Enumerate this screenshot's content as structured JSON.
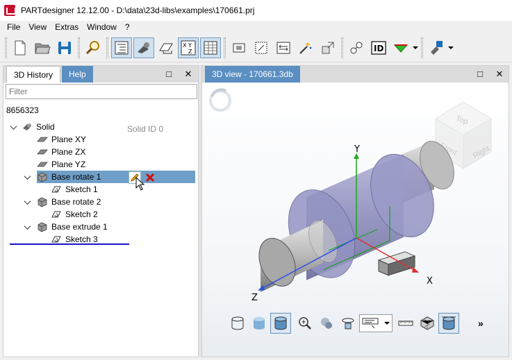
{
  "window": {
    "title": "PARTdesigner 12.12.00 - D:\\data\\23d-libs\\examples\\170661.prj"
  },
  "menu": [
    "File",
    "View",
    "Extras",
    "Window",
    "?"
  ],
  "toolbar": {
    "icons": [
      "new-file-icon",
      "open-folder-icon",
      "save-icon",
      "search-icon",
      "tree-view-icon",
      "camera-icon",
      "sketch-plane-icon",
      "xyz-axes-icon",
      "table-icon",
      "part-icon",
      "dimension-icon",
      "measure-icon",
      "magic-wand-icon",
      "export-icon",
      "assembly-icon",
      "id-icon",
      "variant-icon",
      "save-bolt-icon"
    ],
    "accent_green": "#2db82d",
    "accent_red": "#d01010"
  },
  "left_panel": {
    "tabs": [
      "3D History",
      "Help"
    ],
    "filter_placeholder": "Filter",
    "root_id": "8656323",
    "solid_id": "Solid ID 0",
    "tree": [
      {
        "label": "Solid",
        "icon": "solid-icon"
      },
      {
        "label": "Plane XY",
        "icon": "plane-icon"
      },
      {
        "label": "Plane ZX",
        "icon": "plane-icon"
      },
      {
        "label": "Plane YZ",
        "icon": "plane-icon"
      },
      {
        "label": "Base rotate 1",
        "icon": "feature-icon"
      },
      {
        "label": "Sketch 1",
        "icon": "sketch-icon"
      },
      {
        "label": "Base rotate 2",
        "icon": "feature-icon"
      },
      {
        "label": "Sketch 2",
        "icon": "sketch-icon"
      },
      {
        "label": "Base extrude 1",
        "icon": "feature-icon"
      },
      {
        "label": "Sketch 3",
        "icon": "sketch-icon"
      }
    ],
    "selection_color": "#6f9fc8"
  },
  "right_panel": {
    "tab": "3D view - 170661.3db",
    "cube_faces": [
      "Top",
      "Front",
      "Right"
    ],
    "axes": {
      "x": "X",
      "y": "Y",
      "z": "Z"
    },
    "axis_colors": {
      "x": "#e03030",
      "y": "#22aa22",
      "z": "#3050e0"
    },
    "view_tools": [
      "wireframe-cylinder-icon",
      "shaded-cylinder-icon",
      "solid-cylinder-icon",
      "zoom-icon",
      "rotate-view-icon",
      "orbit-icon",
      "measure-combo-icon",
      "ruler-icon",
      "mesh-icon",
      "section-icon"
    ],
    "more": "»"
  }
}
